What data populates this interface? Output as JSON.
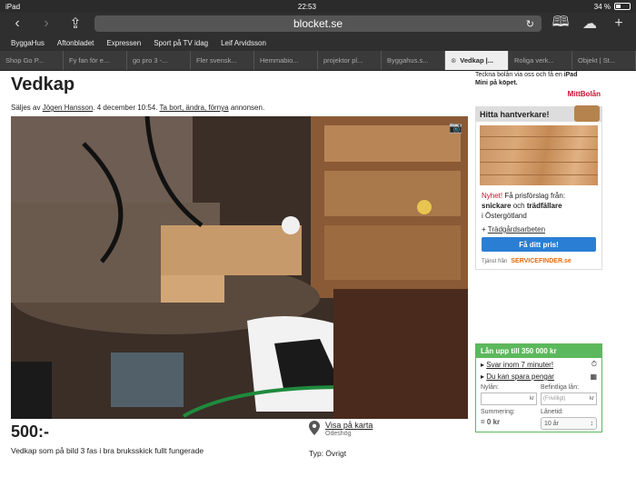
{
  "status": {
    "device": "iPad",
    "time": "22:53",
    "battery": "34 %"
  },
  "browser": {
    "url": "blocket.se"
  },
  "bookmarks": [
    "ByggaHus",
    "Aftonbladet",
    "Expressen",
    "Sport på TV idag",
    "Leif Arvidsson"
  ],
  "tabs": [
    {
      "label": "Shop Go P...",
      "active": false
    },
    {
      "label": "Fy fan för e...",
      "active": false
    },
    {
      "label": "go pro 3 -...",
      "active": false
    },
    {
      "label": "Fler svensk...",
      "active": false
    },
    {
      "label": "Hemmabio...",
      "active": false
    },
    {
      "label": "projektor pl...",
      "active": false
    },
    {
      "label": "Byggahus.s...",
      "active": false
    },
    {
      "label": "Vedkap |...",
      "active": true
    },
    {
      "label": "Roliga verk...",
      "active": false
    },
    {
      "label": "Objekt | St...",
      "active": false
    }
  ],
  "listing": {
    "title": "Vedkap",
    "sold_by_prefix": "Säljes av",
    "seller": "Jögen Hansson",
    "date": ". 4 december 10:54.",
    "edit_link": "Ta bort, ändra, förnya",
    "edit_suffix": "annonsen.",
    "price": "500:-",
    "description": "Vedkap som på bild 3 fas i bra bruksskick fullt fungerade",
    "map_link": "Visa på karta",
    "location": "Ödeshög",
    "type": "Typ: Övrigt"
  },
  "ad_top": {
    "text": "Teckna bolån via oss och få en",
    "bold1": "iPad",
    "bold2": "Mini på köpet.",
    "logo": "MittBolån"
  },
  "hantverkare": {
    "title": "Hitta hantverkare!",
    "new_label": "Nyhet!",
    "text1": "Få prisförslag från:",
    "link1": "snickare",
    "and": "och",
    "link2": "trädfällare",
    "text2": "i Östergötland",
    "more_link": "Trädgårdsarbeten",
    "button": "Få ditt pris!",
    "footer": "Tjänst från",
    "brand": "SERVICEFINDER.se"
  },
  "loan": {
    "title": "Lån upp till 350 000 kr",
    "row1": "Svar inom 7 minuter!",
    "row2": "Du kan spara pengar",
    "new_loan": "Nylån:",
    "existing": "Befintliga lån:",
    "optional": "(Frivilligt)",
    "kr": "kr",
    "sum_label": "Summering:",
    "sum_value": "= 0 kr",
    "term_label": "Lånetid:",
    "term_value": "10 år"
  }
}
